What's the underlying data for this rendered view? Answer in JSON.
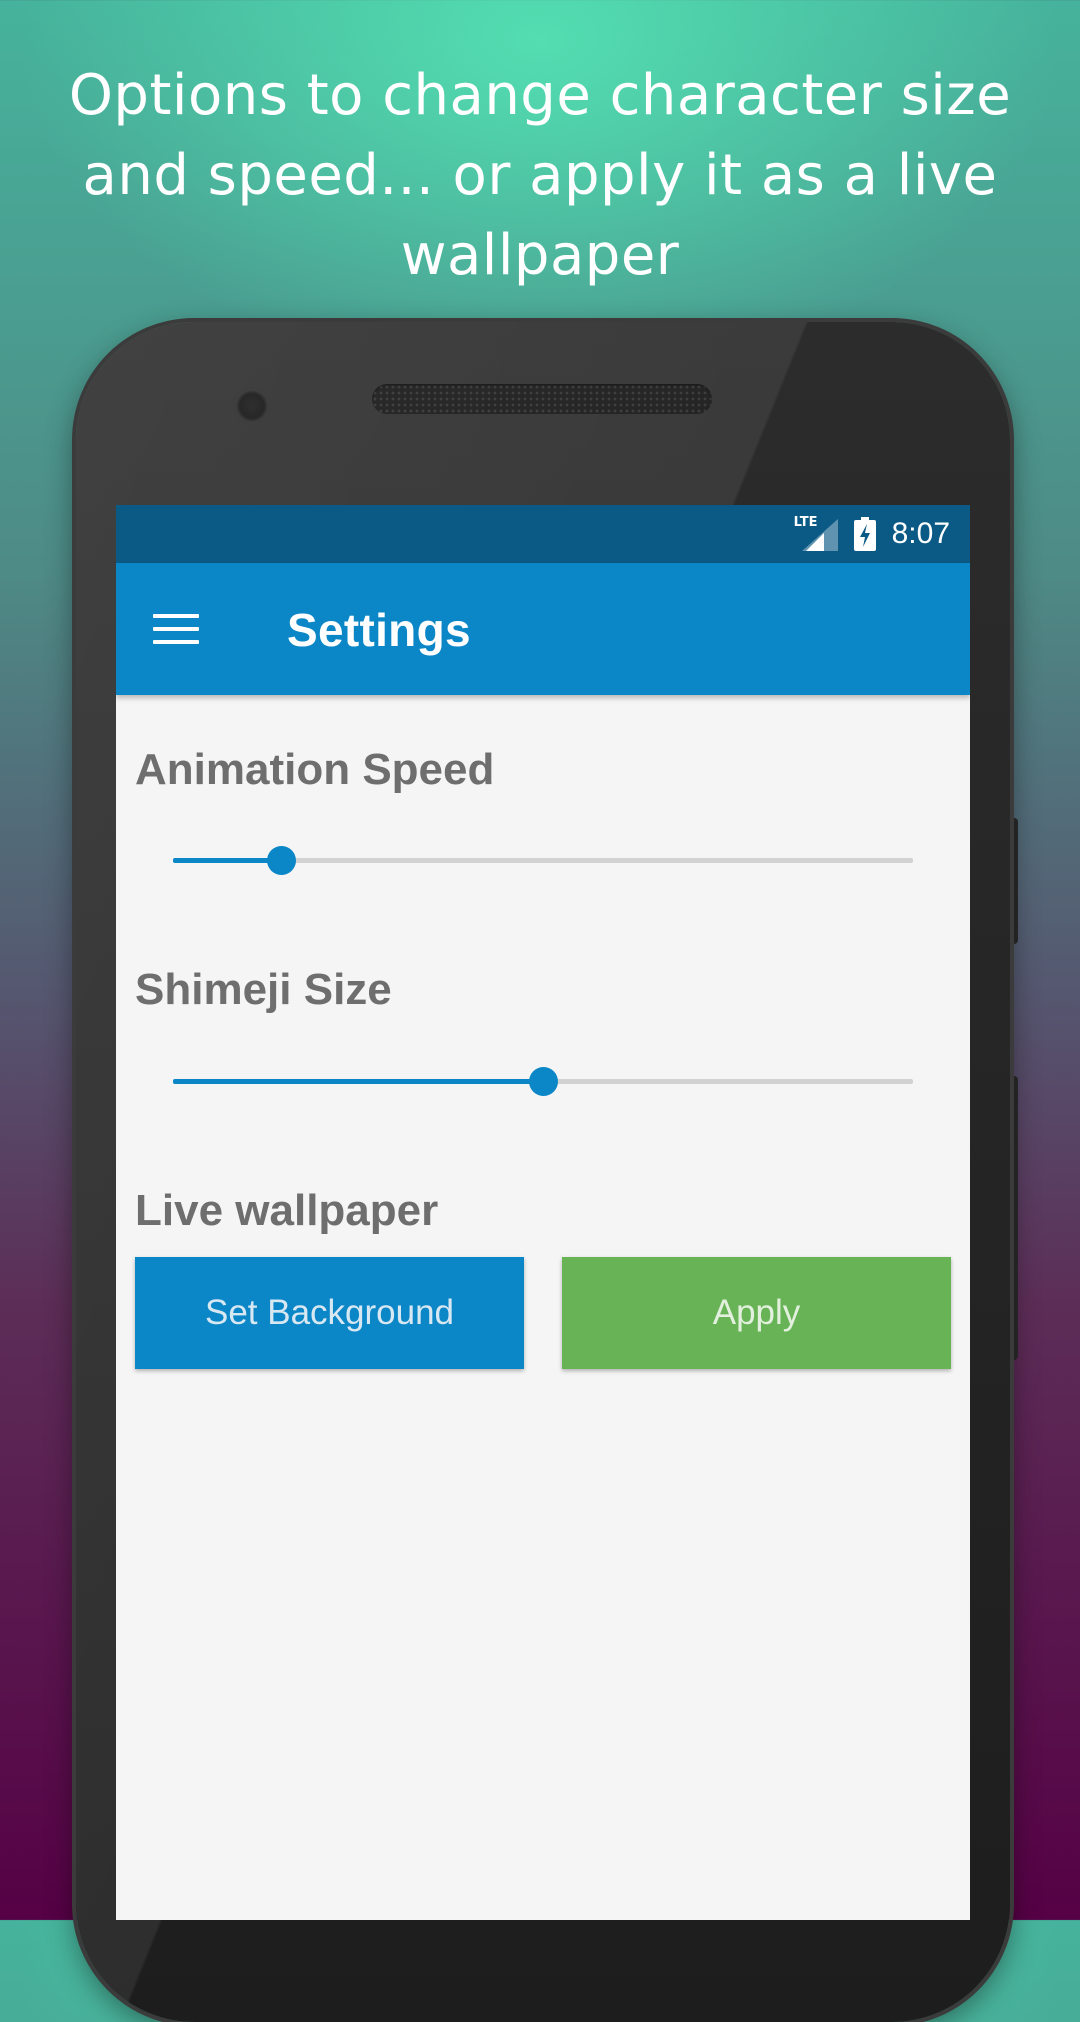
{
  "promo": {
    "headline": "Options to change character size and speed... or apply it as a live wallpaper"
  },
  "status_bar": {
    "network": "LTE",
    "time": "8:07"
  },
  "app_bar": {
    "menu_icon": "hamburger-menu-icon",
    "title": "Settings"
  },
  "settings": {
    "animation_speed": {
      "label": "Animation Speed",
      "value_fraction": 0.146
    },
    "shimeji_size": {
      "label": "Shimeji Size",
      "value_fraction": 0.5
    },
    "live_wallpaper": {
      "label": "Live wallpaper",
      "set_background_label": "Set Background",
      "apply_label": "Apply"
    }
  },
  "colors": {
    "primary": "#0b87c7",
    "primary_dark": "#0b5a85",
    "apply_green": "#67b356",
    "screen_background": "#f5f5f5",
    "label_gray": "#6e6e6e"
  }
}
